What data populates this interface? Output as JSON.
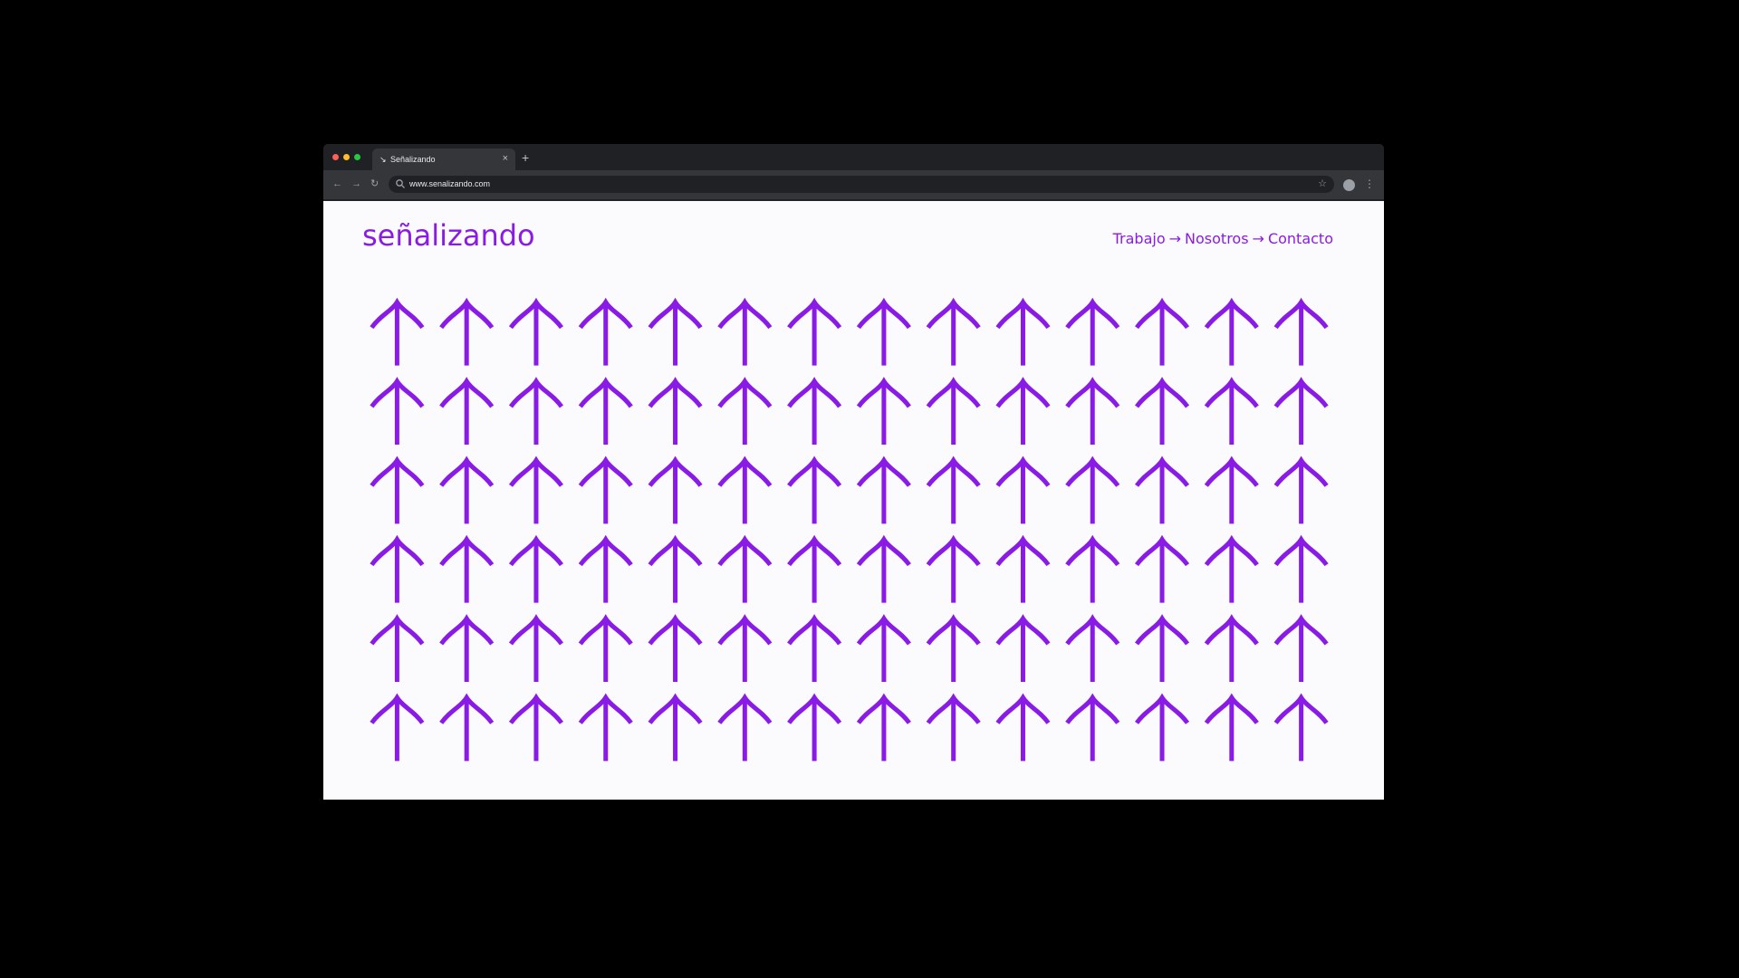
{
  "browser": {
    "tab_title": "Señalizando",
    "new_tab_label": "+",
    "close_tab_label": "×",
    "url": "www.senalizando.com",
    "traffic_colors": [
      "#ff5f57",
      "#febc2e",
      "#28c840"
    ]
  },
  "site": {
    "logo": "señalizando",
    "brand_color": "#8a1be6",
    "nav": {
      "items": [
        "Trabajo",
        "Nosotros",
        "Contacto"
      ],
      "separator": "→"
    },
    "pattern": {
      "icon": "up-arrow-icon",
      "rows": 6,
      "columns": 14
    }
  }
}
